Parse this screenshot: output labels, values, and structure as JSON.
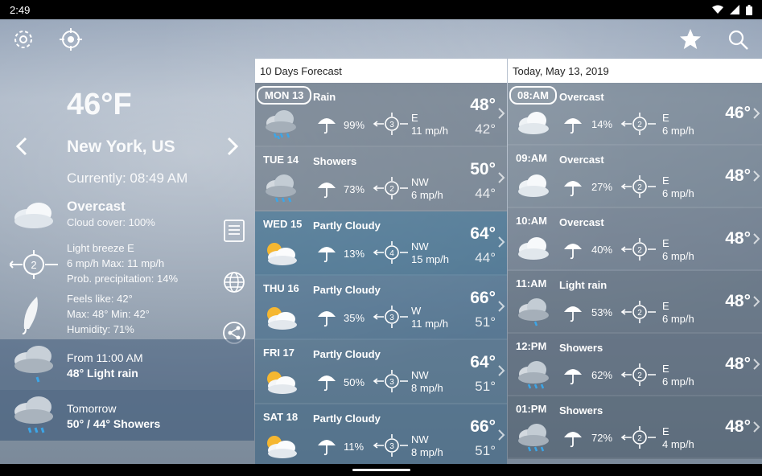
{
  "status": {
    "time": "2:49"
  },
  "toolbar": {
    "settings": "settings-icon",
    "locate": "crosshair-icon",
    "favorite": "star-icon",
    "search": "search-icon"
  },
  "current": {
    "temperature": "46°F",
    "city": "New York, US",
    "currently": "Currently: 08:49 AM",
    "condition": "Overcast",
    "cloud_cover": "Cloud cover: 100%",
    "wind_line1": "Light breeze E",
    "wind_line2": "6 mp/h Max: 11 mp/h",
    "precip": "Prob. precipitation: 14%",
    "feels": "Feels like: 42°",
    "maxmin": "Max: 48° Min: 42°",
    "humidity": "Humidity: 71%",
    "wind_badge": "2",
    "next_label": "From 11:00 AM",
    "next_value": "48° Light rain",
    "tomorrow_label": "Tomorrow",
    "tomorrow_value": "50° / 44° Showers"
  },
  "forecast": {
    "header": "10 Days Forecast",
    "days": [
      {
        "day": "MON 13",
        "cond": "Rain",
        "pct": "99%",
        "dir": "E",
        "speed": "11 mp/h",
        "bf": "3",
        "hi": "48°",
        "lo": "42°",
        "icon": "rain"
      },
      {
        "day": "TUE 14",
        "cond": "Showers",
        "pct": "73%",
        "dir": "NW",
        "speed": "6 mp/h",
        "bf": "2",
        "hi": "50°",
        "lo": "44°",
        "icon": "showers"
      },
      {
        "day": "WED 15",
        "cond": "Partly Cloudy",
        "pct": "13%",
        "dir": "NW",
        "speed": "15 mp/h",
        "bf": "4",
        "hi": "64°",
        "lo": "44°",
        "icon": "partly"
      },
      {
        "day": "THU 16",
        "cond": "Partly Cloudy",
        "pct": "35%",
        "dir": "W",
        "speed": "11 mp/h",
        "bf": "3",
        "hi": "66°",
        "lo": "51°",
        "icon": "partly"
      },
      {
        "day": "FRI 17",
        "cond": "Partly Cloudy",
        "pct": "50%",
        "dir": "NW",
        "speed": "8 mp/h",
        "bf": "3",
        "hi": "64°",
        "lo": "51°",
        "icon": "partly"
      },
      {
        "day": "SAT 18",
        "cond": "Partly Cloudy",
        "pct": "11%",
        "dir": "NW",
        "speed": "8 mp/h",
        "bf": "3",
        "hi": "66°",
        "lo": "51°",
        "icon": "partly"
      }
    ]
  },
  "hourly": {
    "header": "Today, May 13, 2019",
    "hours": [
      {
        "time": "08:AM",
        "cond": "Overcast",
        "pct": "14%",
        "dir": "E",
        "speed": "6 mp/h",
        "bf": "2",
        "temp": "46°",
        "icon": "cloud"
      },
      {
        "time": "09:AM",
        "cond": "Overcast",
        "pct": "27%",
        "dir": "E",
        "speed": "6 mp/h",
        "bf": "2",
        "temp": "48°",
        "icon": "cloud"
      },
      {
        "time": "10:AM",
        "cond": "Overcast",
        "pct": "40%",
        "dir": "E",
        "speed": "6 mp/h",
        "bf": "2",
        "temp": "48°",
        "icon": "cloud"
      },
      {
        "time": "11:AM",
        "cond": "Light rain",
        "pct": "53%",
        "dir": "E",
        "speed": "6 mp/h",
        "bf": "2",
        "temp": "48°",
        "icon": "lightrain"
      },
      {
        "time": "12:PM",
        "cond": "Showers",
        "pct": "62%",
        "dir": "E",
        "speed": "6 mp/h",
        "bf": "2",
        "temp": "48°",
        "icon": "showers"
      },
      {
        "time": "01:PM",
        "cond": "Showers",
        "pct": "72%",
        "dir": "E",
        "speed": "4 mp/h",
        "bf": "2",
        "temp": "48°",
        "icon": "showers"
      }
    ]
  }
}
